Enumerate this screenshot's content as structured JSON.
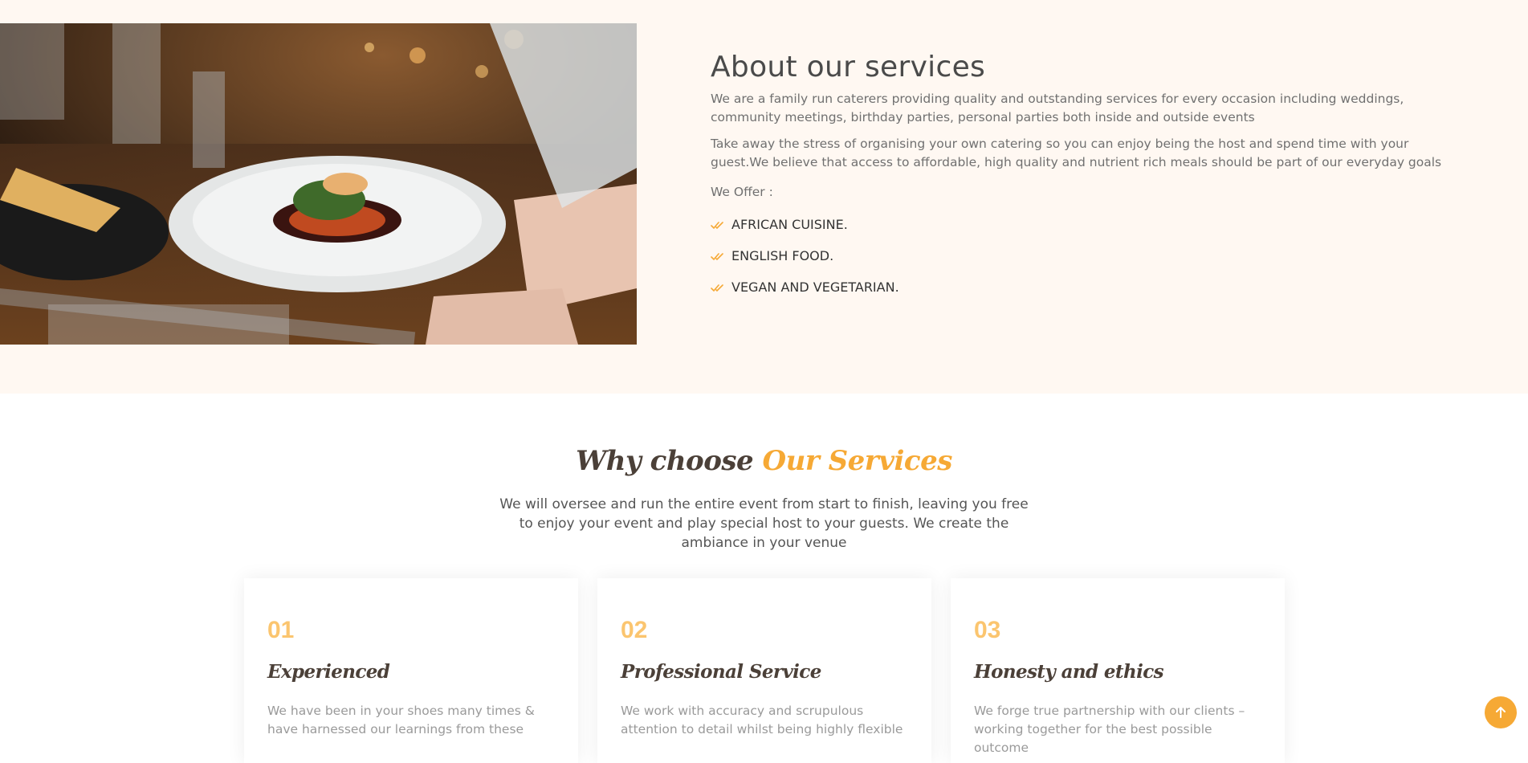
{
  "about": {
    "title": "About our services",
    "paragraph_1": "We are a family run caterers providing quality and outstanding services for every occasion including weddings, community meetings, birthday parties, personal parties both inside and outside events",
    "paragraph_2": "Take away the stress of organising your own catering so you can enjoy being the host and spend time with your guest.We believe that access to affordable, high quality and nutrient rich meals should be part of our everyday goals",
    "offer_label": "We Offer :",
    "offers": [
      "AFRICAN CUISINE.",
      "ENGLISH FOOD.",
      "VEGAN AND VEGETARIAN."
    ]
  },
  "why": {
    "title_part1": "Why choose",
    "title_part2": "Our Services",
    "subtitle": "We will oversee and run the entire event from start to finish, leaving you free to enjoy your event and play special host to your guests. We create the ambiance in your venue",
    "cards": [
      {
        "number": "01",
        "title": "Experienced",
        "text": "We have been in your shoes many times & have harnessed our learnings from these"
      },
      {
        "number": "02",
        "title": "Professional Service",
        "text": "We work with accuracy and scrupulous attention to detail whilst being highly flexible"
      },
      {
        "number": "03",
        "title": "Honesty and ethics",
        "text": "We forge true partnership with our clients – working together for the best possible outcome"
      }
    ]
  },
  "scroll_top": {
    "icon": "arrow-up-icon"
  },
  "colors": {
    "accent": "#f6a935",
    "about_bg": "#fff8f2",
    "card_number": "#fbc56f",
    "heading": "#4b4038"
  }
}
